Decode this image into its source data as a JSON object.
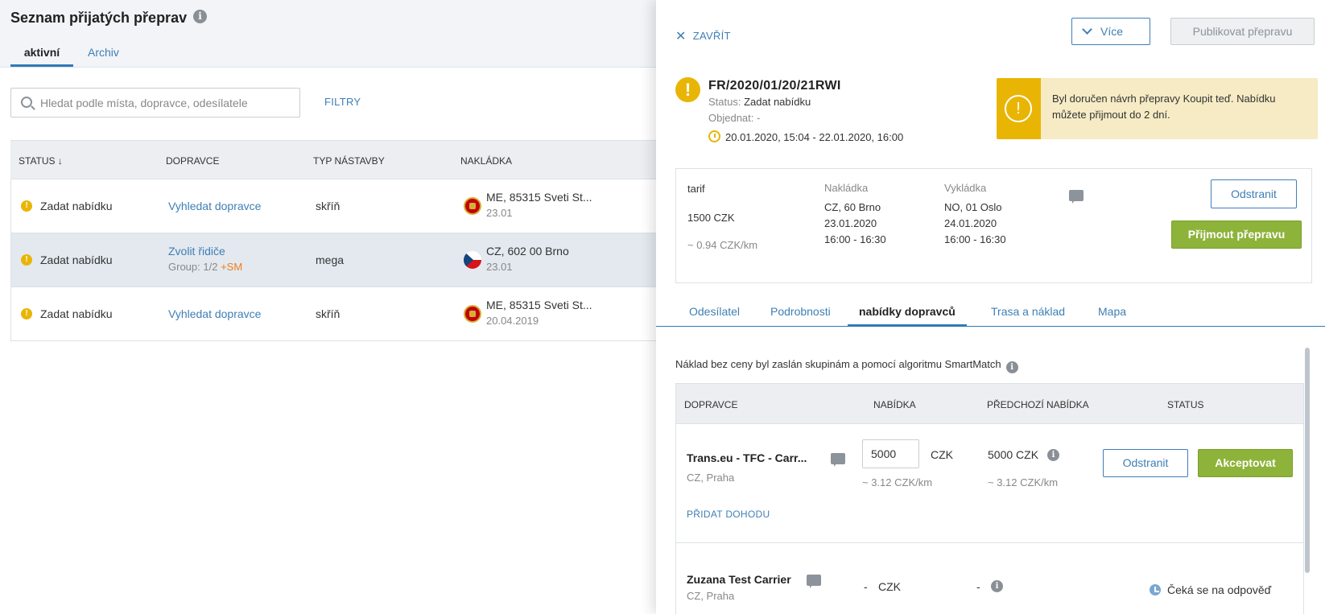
{
  "list": {
    "title": "Seznam přijatých přeprav",
    "tabs": [
      "aktivní",
      "Archiv"
    ],
    "search_placeholder": "Hledat podle místa, dopravce, odesílatele",
    "filters_label": "FILTRY",
    "columns": [
      "STATUS ↓",
      "DOPRAVCE",
      "TYP NÁSTAVBY",
      "NAKLÁDKA"
    ],
    "rows": [
      {
        "status": "Zadat nabídku",
        "carrier": "Vyhledat dopravce",
        "carrier_sub": "",
        "carrier_sub_tag": "",
        "body": "skříň",
        "loading": "ME, 85315 Sveti St...",
        "loading_date": "23.01",
        "flag": "ME"
      },
      {
        "status": "Zadat nabídku",
        "carrier": "Zvolit řidiče",
        "carrier_sub": "Group: 1/2",
        "carrier_sub_tag": "+SM",
        "body": "mega",
        "loading": "CZ, 602 00 Brno",
        "loading_date": "23.01",
        "flag": "CZ"
      },
      {
        "status": "Zadat nabídku",
        "carrier": "Vyhledat dopravce",
        "carrier_sub": "",
        "carrier_sub_tag": "",
        "body": "skříň",
        "loading": "ME, 85315 Sveti St...",
        "loading_date": "20.04.2019",
        "flag": "ME"
      }
    ]
  },
  "panel": {
    "close_label": "ZAVŘÍT",
    "more_label": "Více",
    "publish_label": "Publikovat přepravu",
    "ref": "FR/2020/01/20/21RWI",
    "status_label": "Status:",
    "status_value": "Zadat nabídku",
    "order_label": "Objednat:",
    "order_value": "-",
    "period": "20.01.2020, 15:04 - 22.01.2020, 16:00",
    "notice": "Byl doručen návrh přepravy Koupit teď. Nabídku můžete přijmout do 2 dní.",
    "summary": {
      "tariff_label": "tarif",
      "tariff_value": "1500  CZK",
      "tariff_per_km": "~ 0.94  CZK/km",
      "loading_label": "Nakládka",
      "loading_place": "CZ, 60 Brno",
      "loading_date": "23.01.2020",
      "loading_time": "16:00 - 16:30",
      "unloading_label": "Vykládka",
      "unloading_place": "NO, 01 Oslo",
      "unloading_date": "24.01.2020",
      "unloading_time": "16:00 - 16:30",
      "remove_label": "Odstranit",
      "accept_label": "Přijmout přepravu"
    },
    "tabs": [
      "Odesílatel",
      "Podrobnosti",
      "nabídky dopravců",
      "Trasa a náklad",
      "Mapa"
    ],
    "note": "Náklad bez ceny byl zaslán skupinám a pomocí algoritmu SmartMatch",
    "offers": {
      "columns": [
        "DOPRAVCE",
        "NABÍDKA",
        "PŘEDCHOZÍ NABÍDKA",
        "STATUS"
      ],
      "rows": [
        {
          "carrier": "Trans.eu - TFC - Carr...",
          "location": "CZ, Praha",
          "offer": "5000",
          "currency": "CZK",
          "offer_per_km": "~ 3.12  CZK/km",
          "prev_offer": "5000  CZK",
          "prev_per_km": "~ 3.12  CZK/km",
          "add_deal": "PŘIDAT DOHODU",
          "remove_label": "Odstranit",
          "accept_label": "Akceptovat"
        },
        {
          "carrier": "Zuzana Test Carrier",
          "location": "CZ, Praha",
          "offer": "-",
          "currency": "CZK",
          "prev_offer": "-",
          "status": "Čeká se na odpověď"
        }
      ]
    }
  },
  "colors": {
    "accent": "#3f7fb5",
    "warning": "#e9b505",
    "success": "#8db33a",
    "orange": "#ef7d1a"
  }
}
